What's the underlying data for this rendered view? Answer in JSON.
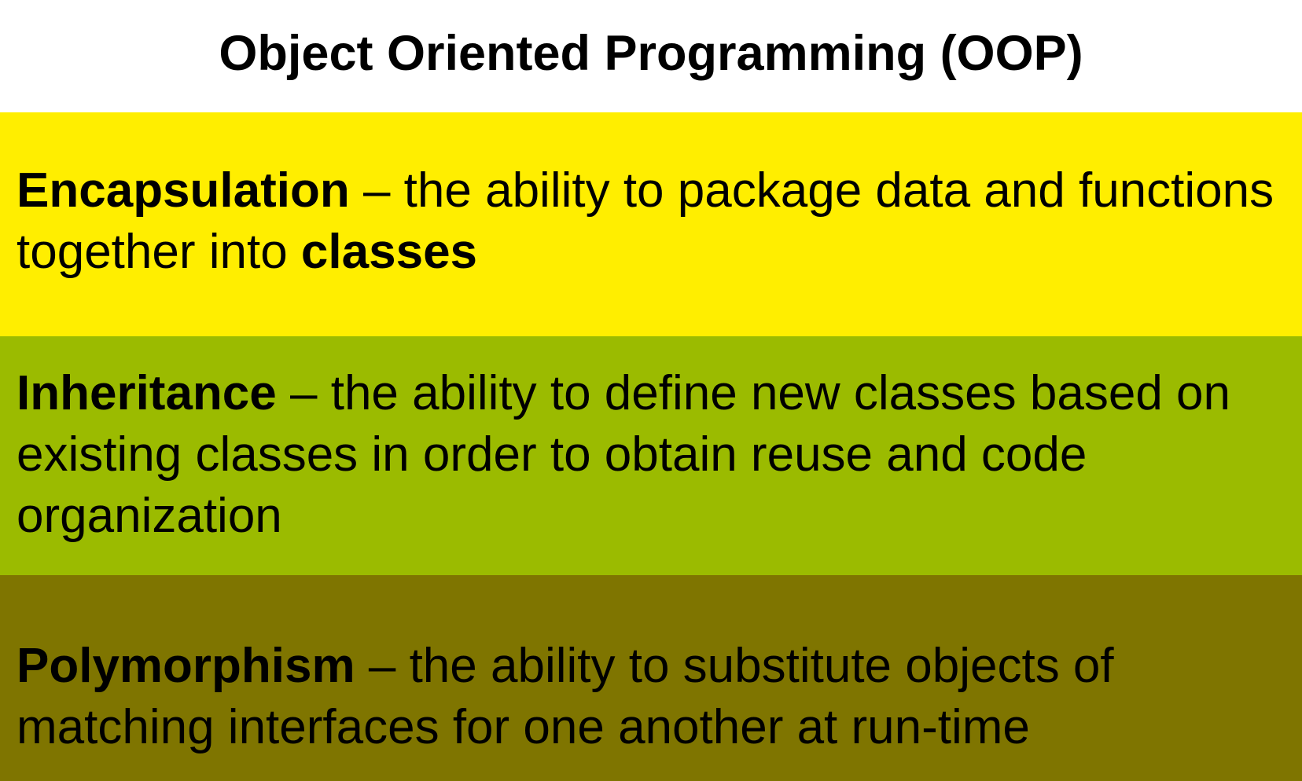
{
  "slide": {
    "title": "Object Oriented Programming (OOP)",
    "concepts": [
      {
        "term": "Encapsulation",
        "definition_before": " – the ability to package data and functions together into ",
        "emphasis": "classes",
        "definition_after": "",
        "color": "#ffee00"
      },
      {
        "term": "Inheritance",
        "definition_before": " – the ability to define new classes based on existing classes in order to obtain reuse and code organization",
        "emphasis": "",
        "definition_after": "",
        "color": "#9bbb00"
      },
      {
        "term": "Polymorphism",
        "definition_before": " – the ability to substitute objects of matching interfaces for one another at run-time",
        "emphasis": "",
        "definition_after": "",
        "color": "#7f7500"
      }
    ]
  }
}
